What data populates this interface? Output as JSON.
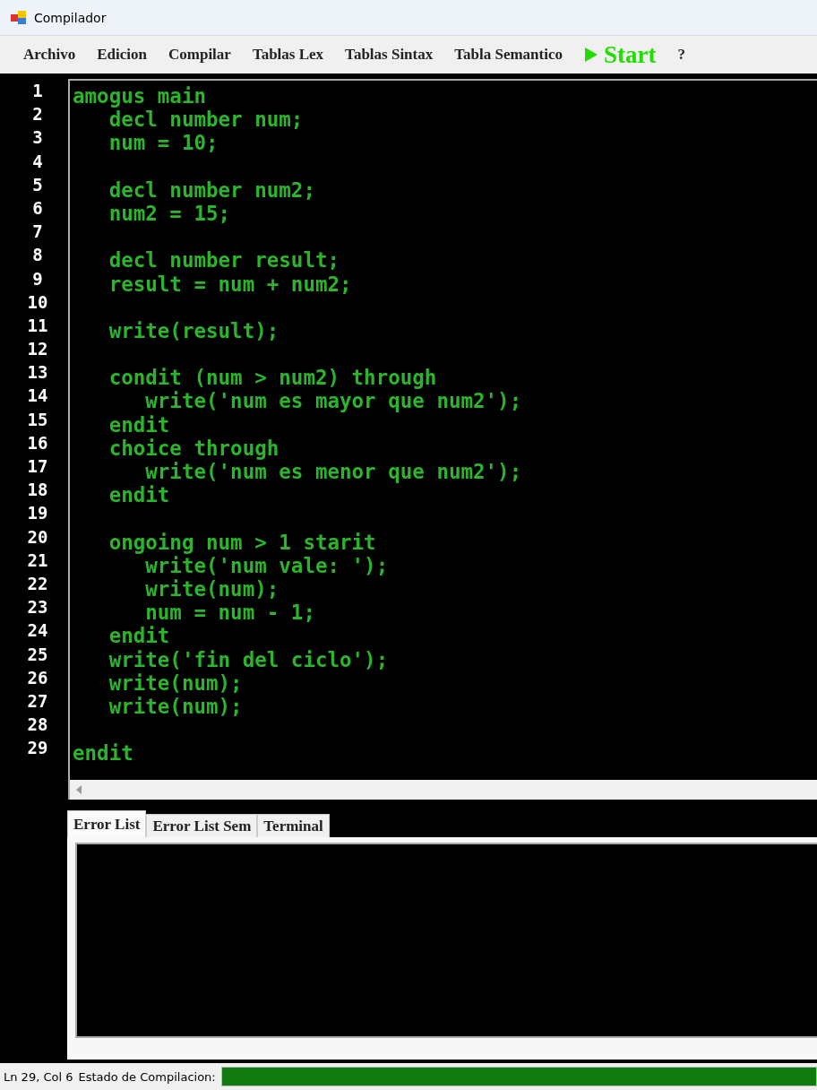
{
  "window": {
    "title": "Compilador"
  },
  "menu": [
    {
      "label": "Archivo",
      "kind": "plain"
    },
    {
      "label": "Edicion",
      "kind": "plain"
    },
    {
      "label": "Compilar",
      "kind": "plain"
    },
    {
      "label": "Tablas Lex",
      "kind": "plain"
    },
    {
      "label": "Tablas Sintax",
      "kind": "plain"
    },
    {
      "label": "Tabla Semantico",
      "kind": "plain"
    },
    {
      "label": "Start",
      "kind": "run"
    },
    {
      "label": "?",
      "kind": "plain"
    }
  ],
  "editor": {
    "lines": [
      {
        "number": "1",
        "code": "amogus main"
      },
      {
        "number": "2",
        "code": "   decl number num;"
      },
      {
        "number": "3",
        "code": "   num = 10;"
      },
      {
        "number": "4"
      },
      {
        "number": "5",
        "code": "   decl number num2;"
      },
      {
        "number": "6",
        "code": "   num2 = 15;"
      },
      {
        "number": "7"
      },
      {
        "number": "8",
        "code": "   decl number result;"
      },
      {
        "number": "9",
        "code": "   result = num + num2;"
      },
      {
        "number": "10"
      },
      {
        "number": "11",
        "code": "   write(result);"
      },
      {
        "number": "12"
      },
      {
        "number": "13",
        "code": "   condit (num > num2) through"
      },
      {
        "number": "14",
        "code": "      write('num es mayor que num2');"
      },
      {
        "number": "15",
        "code": "   endit"
      },
      {
        "number": "16",
        "code": "   choice through"
      },
      {
        "number": "17",
        "code": "      write('num es menor que num2');"
      },
      {
        "number": "18",
        "code": "   endit"
      },
      {
        "number": "19"
      },
      {
        "number": "20",
        "code": "   ongoing num > 1 starit"
      },
      {
        "number": "21",
        "code": "      write('num vale: ');"
      },
      {
        "number": "22",
        "code": "      write(num);"
      },
      {
        "number": "23",
        "code": "      num = num - 1;"
      },
      {
        "number": "24",
        "code": "   endit"
      },
      {
        "number": "25",
        "code": "   write('fin del ciclo');"
      },
      {
        "number": "26",
        "code": "   write(num);"
      },
      {
        "number": "27",
        "code": "   write(num);"
      },
      {
        "number": "28"
      },
      {
        "number": "29",
        "code": "endit"
      }
    ]
  },
  "tabs": [
    {
      "label": "Error List",
      "selected": true
    },
    {
      "label": "Error List Sem",
      "selected": false
    },
    {
      "label": "Terminal",
      "selected": false
    }
  ],
  "status_bar": {
    "position": "Ln 29, Col 6",
    "status_label": "Estado de Compilacion:",
    "progress": {
      "level": 1
    }
  }
}
